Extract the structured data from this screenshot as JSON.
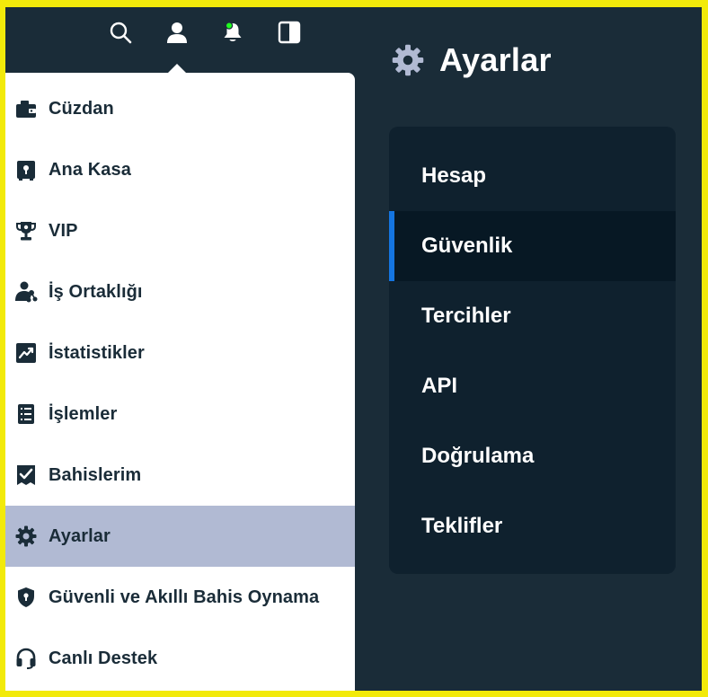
{
  "icons": {
    "search": "search-icon",
    "user": "user-icon",
    "notifications": "bell-icon",
    "sidebar_toggle": "panel-toggle-icon"
  },
  "colors": {
    "background": "#1a2c38",
    "panel": "#0f212e",
    "active_nav": "#071824",
    "accent": "#1475e1",
    "menu_active": "#b1bad3",
    "notification_dot": "#1fff20",
    "border": "#f2ea0a"
  },
  "user_menu": {
    "items": [
      {
        "label": "Cüzdan",
        "icon": "wallet-icon"
      },
      {
        "label": "Ana Kasa",
        "icon": "vault-icon"
      },
      {
        "label": "VIP",
        "icon": "trophy-icon"
      },
      {
        "label": "İş Ortaklığı",
        "icon": "affiliate-icon"
      },
      {
        "label": "İstatistikler",
        "icon": "chart-icon"
      },
      {
        "label": "İşlemler",
        "icon": "transactions-icon"
      },
      {
        "label": "Bahislerim",
        "icon": "bets-icon"
      },
      {
        "label": "Ayarlar",
        "icon": "gear-icon",
        "active": true
      },
      {
        "label": "Güvenli ve Akıllı Bahis Oynama",
        "icon": "shield-icon"
      },
      {
        "label": "Canlı Destek",
        "icon": "headset-icon"
      }
    ]
  },
  "settings": {
    "title": "Ayarlar",
    "title_icon": "gear-icon",
    "nav": [
      {
        "label": "Hesap"
      },
      {
        "label": "Güvenlik",
        "active": true
      },
      {
        "label": "Tercihler"
      },
      {
        "label": "API"
      },
      {
        "label": "Doğrulama"
      },
      {
        "label": "Teklifler"
      }
    ]
  }
}
